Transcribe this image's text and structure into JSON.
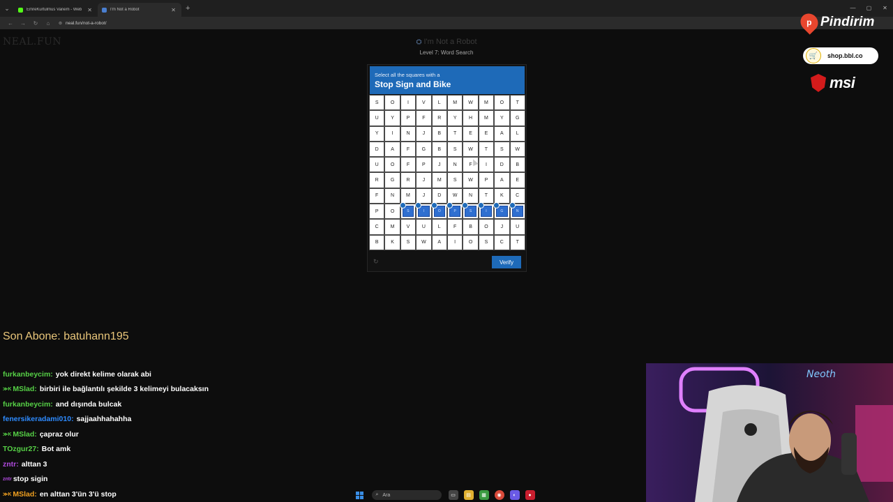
{
  "browser": {
    "tabs": [
      {
        "label": "EmreKurtulmus Vanem - Web",
        "favicon_color": "#53fc18",
        "active": false
      },
      {
        "label": "I'm Not a Robot",
        "favicon_color": "#4a7fd0",
        "active": true
      }
    ],
    "new_tab_label": "+",
    "url": "neal.fun/not-a-robot/"
  },
  "page": {
    "site_logo": "NEAL.FUN",
    "title": "I'm Not a Robot",
    "level": "Level 7: Word Search"
  },
  "captcha": {
    "instruction": "Select all the squares with a",
    "target": "Stop Sign and Bike",
    "grid": [
      [
        "S",
        "O",
        "I",
        "V",
        "L",
        "M",
        "W",
        "M",
        "O",
        "T"
      ],
      [
        "U",
        "Y",
        "P",
        "F",
        "R",
        "Y",
        "H",
        "M",
        "Y",
        "G"
      ],
      [
        "Y",
        "I",
        "N",
        "J",
        "B",
        "T",
        "E",
        "E",
        "A",
        "L"
      ],
      [
        "D",
        "A",
        "F",
        "G",
        "B",
        "S",
        "W",
        "T",
        "S",
        "W"
      ],
      [
        "U",
        "O",
        "F",
        "P",
        "J",
        "N",
        "F",
        "I",
        "D",
        "B"
      ],
      [
        "R",
        "G",
        "R",
        "J",
        "M",
        "S",
        "W",
        "P",
        "A",
        "E"
      ],
      [
        "F",
        "N",
        "M",
        "J",
        "D",
        "W",
        "N",
        "T",
        "K",
        "C"
      ],
      [
        "P",
        "O",
        "S",
        "I",
        "O",
        "P",
        "S",
        "I",
        "G",
        "N"
      ],
      [
        "C",
        "M",
        "V",
        "U",
        "L",
        "F",
        "B",
        "O",
        "J",
        "U"
      ],
      [
        "B",
        "K",
        "S",
        "W",
        "A",
        "I",
        "O",
        "S",
        "C",
        "T"
      ]
    ],
    "selected": [
      [
        7,
        2
      ],
      [
        7,
        3
      ],
      [
        7,
        4
      ],
      [
        7,
        5
      ],
      [
        7,
        6
      ],
      [
        7,
        7
      ],
      [
        7,
        8
      ],
      [
        7,
        9
      ]
    ],
    "verify_label": "Verify",
    "accent_color": "#1e6ab8"
  },
  "sponsors": {
    "pindirim": "Pindirim",
    "shop": "shop.bbl.co",
    "msi": "msi"
  },
  "stream": {
    "last_sub": "Son Abone: batuhann195",
    "chat": [
      {
        "user": "furkanbeycim:",
        "text": "yok direkt kelime olarak abi",
        "color": "#56d146",
        "badge": ""
      },
      {
        "user": "MSlad:",
        "text": "birbiri ile bağlantılı şekilde 3 kelimeyi bulacaksın",
        "color": "#56d146",
        "badge": "≫K"
      },
      {
        "user": "furkanbeycim:",
        "text": "and dışında bulcak",
        "color": "#56d146",
        "badge": ""
      },
      {
        "user": "fenersikeradami010:",
        "text": "sajjaahhahahha",
        "color": "#2e8bff",
        "badge": ""
      },
      {
        "user": "MSlad:",
        "text": "çapraz olur",
        "color": "#56d146",
        "badge": "≫K"
      },
      {
        "user": "TOzgur27:",
        "text": "Bot amk",
        "color": "#56d146",
        "badge": ""
      },
      {
        "user": "zntr:",
        "text": "alttan 3",
        "color": "#b04adf",
        "badge": ""
      },
      {
        "user": "",
        "text": "stop sigin",
        "color": "#b04adf",
        "badge": "zntr"
      },
      {
        "user": "MSlad:",
        "text": "en alttan 3'ün 3'ü stop",
        "color": "#f0a020",
        "badge": "≫K"
      }
    ]
  },
  "taskbar": {
    "search_placeholder": "Ara"
  }
}
